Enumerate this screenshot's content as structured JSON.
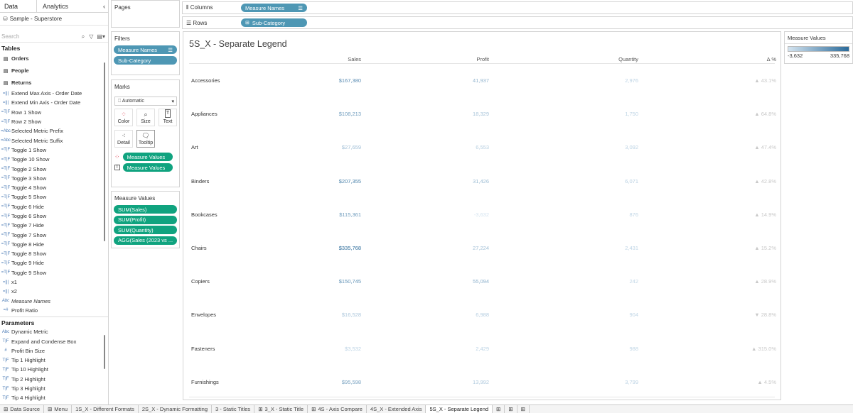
{
  "left": {
    "tabs": [
      "Data",
      "Analytics"
    ],
    "datasource": "Sample - Superstore",
    "search_placeholder": "Search",
    "tables_header": "Tables",
    "tables": [
      "Orders",
      "People",
      "Returns"
    ],
    "fields": [
      {
        "icon": "=|||",
        "label": "Extend Max Axis - Order Date"
      },
      {
        "icon": "=|||",
        "label": "Extend Min Axis - Order Date"
      },
      {
        "icon": "=T|F",
        "label": "Row 1 Show"
      },
      {
        "icon": "=T|F",
        "label": "Row 2 Show"
      },
      {
        "icon": "=Abc",
        "label": "Selected Metric Prefix"
      },
      {
        "icon": "=Abc",
        "label": "Selected Metric Suffix"
      },
      {
        "icon": "=T|F",
        "label": "Toggle 1 Show"
      },
      {
        "icon": "=T|F",
        "label": "Toggle 10 Show"
      },
      {
        "icon": "=T|F",
        "label": "Toggle 2 Show"
      },
      {
        "icon": "=T|F",
        "label": "Toggle 3 Show"
      },
      {
        "icon": "=T|F",
        "label": "Toggle 4 Show"
      },
      {
        "icon": "=T|F",
        "label": "Toggle 5 Show"
      },
      {
        "icon": "=T|F",
        "label": "Toggle 6 Hide"
      },
      {
        "icon": "=T|F",
        "label": "Toggle 6 Show"
      },
      {
        "icon": "=T|F",
        "label": "Toggle 7 Hide"
      },
      {
        "icon": "=T|F",
        "label": "Toggle 7 Show"
      },
      {
        "icon": "=T|F",
        "label": "Toggle 8 Hide"
      },
      {
        "icon": "=T|F",
        "label": "Toggle 8 Show"
      },
      {
        "icon": "=T|F",
        "label": "Toggle 9 Hide"
      },
      {
        "icon": "=T|F",
        "label": "Toggle 9 Show"
      },
      {
        "icon": "=|||",
        "label": "x1"
      },
      {
        "icon": "=|||",
        "label": "x2"
      },
      {
        "icon": "Abc",
        "label": "Measure Names"
      },
      {
        "icon": "=#",
        "label": "Profit Ratio"
      }
    ],
    "parameters_header": "Parameters",
    "parameters": [
      {
        "icon": "Abc",
        "label": "Dynamic Metric"
      },
      {
        "icon": "T|F",
        "label": "Expand and Condense Box"
      },
      {
        "icon": "#",
        "label": "Profit Bin Size"
      },
      {
        "icon": "T|F",
        "label": "Tip 1 Highlight"
      },
      {
        "icon": "T|F",
        "label": "Tip 10 Highlight"
      },
      {
        "icon": "T|F",
        "label": "Tip 2 Highlight"
      },
      {
        "icon": "T|F",
        "label": "Tip 3 Highlight"
      },
      {
        "icon": "T|F",
        "label": "Tip 4 Highlight"
      }
    ]
  },
  "shelves": {
    "pages_title": "Pages",
    "filters_title": "Filters",
    "filters": [
      "Measure Names",
      "Sub-Category"
    ],
    "marks_title": "Marks",
    "marks_type": "Automatic",
    "mark_buttons": [
      "Color",
      "Size",
      "Text",
      "Detail",
      "Tooltip"
    ],
    "mark_pills": [
      "Measure Values",
      "Measure Values"
    ],
    "measure_values_title": "Measure Values",
    "measure_values": [
      "SUM(Sales)",
      "SUM(Profit)",
      "SUM(Quantity)",
      "AGG(Sales (2023 vs ..."
    ],
    "columns_label": "Columns",
    "columns_pill": "Measure Names",
    "rows_label": "Rows",
    "rows_pill": "Sub-Category"
  },
  "view": {
    "title": "5S_X - Separate Legend",
    "columns": [
      "Sales",
      "Profit",
      "Quantity",
      "Δ %"
    ],
    "rows": [
      {
        "name": "Accessories",
        "sales": "$167,380",
        "profit": "41,937",
        "quantity": "2,976",
        "delta": "▲ 43.1%"
      },
      {
        "name": "Appliances",
        "sales": "$108,213",
        "profit": "18,329",
        "quantity": "1,750",
        "delta": "▲ 64.8%"
      },
      {
        "name": "Art",
        "sales": "$27,659",
        "profit": "6,553",
        "quantity": "3,092",
        "delta": "▲ 47.4%"
      },
      {
        "name": "Binders",
        "sales": "$207,355",
        "profit": "31,426",
        "quantity": "6,071",
        "delta": "▲ 42.8%"
      },
      {
        "name": "Bookcases",
        "sales": "$115,361",
        "profit": "-3,632",
        "quantity": "876",
        "delta": "▲ 14.9%"
      },
      {
        "name": "Chairs",
        "sales": "$335,768",
        "profit": "27,224",
        "quantity": "2,431",
        "delta": "▲ 15.2%"
      },
      {
        "name": "Copiers",
        "sales": "$150,745",
        "profit": "55,094",
        "quantity": "242",
        "delta": "▲ 28.9%"
      },
      {
        "name": "Envelopes",
        "sales": "$16,528",
        "profit": "6,988",
        "quantity": "904",
        "delta": "▼ 28.8%"
      },
      {
        "name": "Fasteners",
        "sales": "$3,532",
        "profit": "2,429",
        "quantity": "988",
        "delta": "▲ 315.0%"
      },
      {
        "name": "Furnishings",
        "sales": "$95,598",
        "profit": "13,992",
        "quantity": "3,799",
        "delta": "▲ 4.5%"
      }
    ]
  },
  "legend": {
    "title": "Measure Values",
    "min": "-3,632",
    "max": "335,768",
    "color_low": "#d4e4f0",
    "color_high": "#2a6a9a"
  },
  "bottom_tabs": [
    {
      "icon": "grid",
      "label": "Data Source"
    },
    {
      "icon": "grid",
      "label": "Menu"
    },
    {
      "icon": "",
      "label": "1S_X - Different Formats"
    },
    {
      "icon": "",
      "label": "2S_X - Dynamic Formatting"
    },
    {
      "icon": "",
      "label": "3 - Static Titles"
    },
    {
      "icon": "grid",
      "label": "3_X - Static Title"
    },
    {
      "icon": "grid",
      "label": "4S - Axis Compare"
    },
    {
      "icon": "",
      "label": "4S_X - Extended Axis"
    },
    {
      "icon": "",
      "label": "5S_X - Separate Legend",
      "active": true
    }
  ]
}
